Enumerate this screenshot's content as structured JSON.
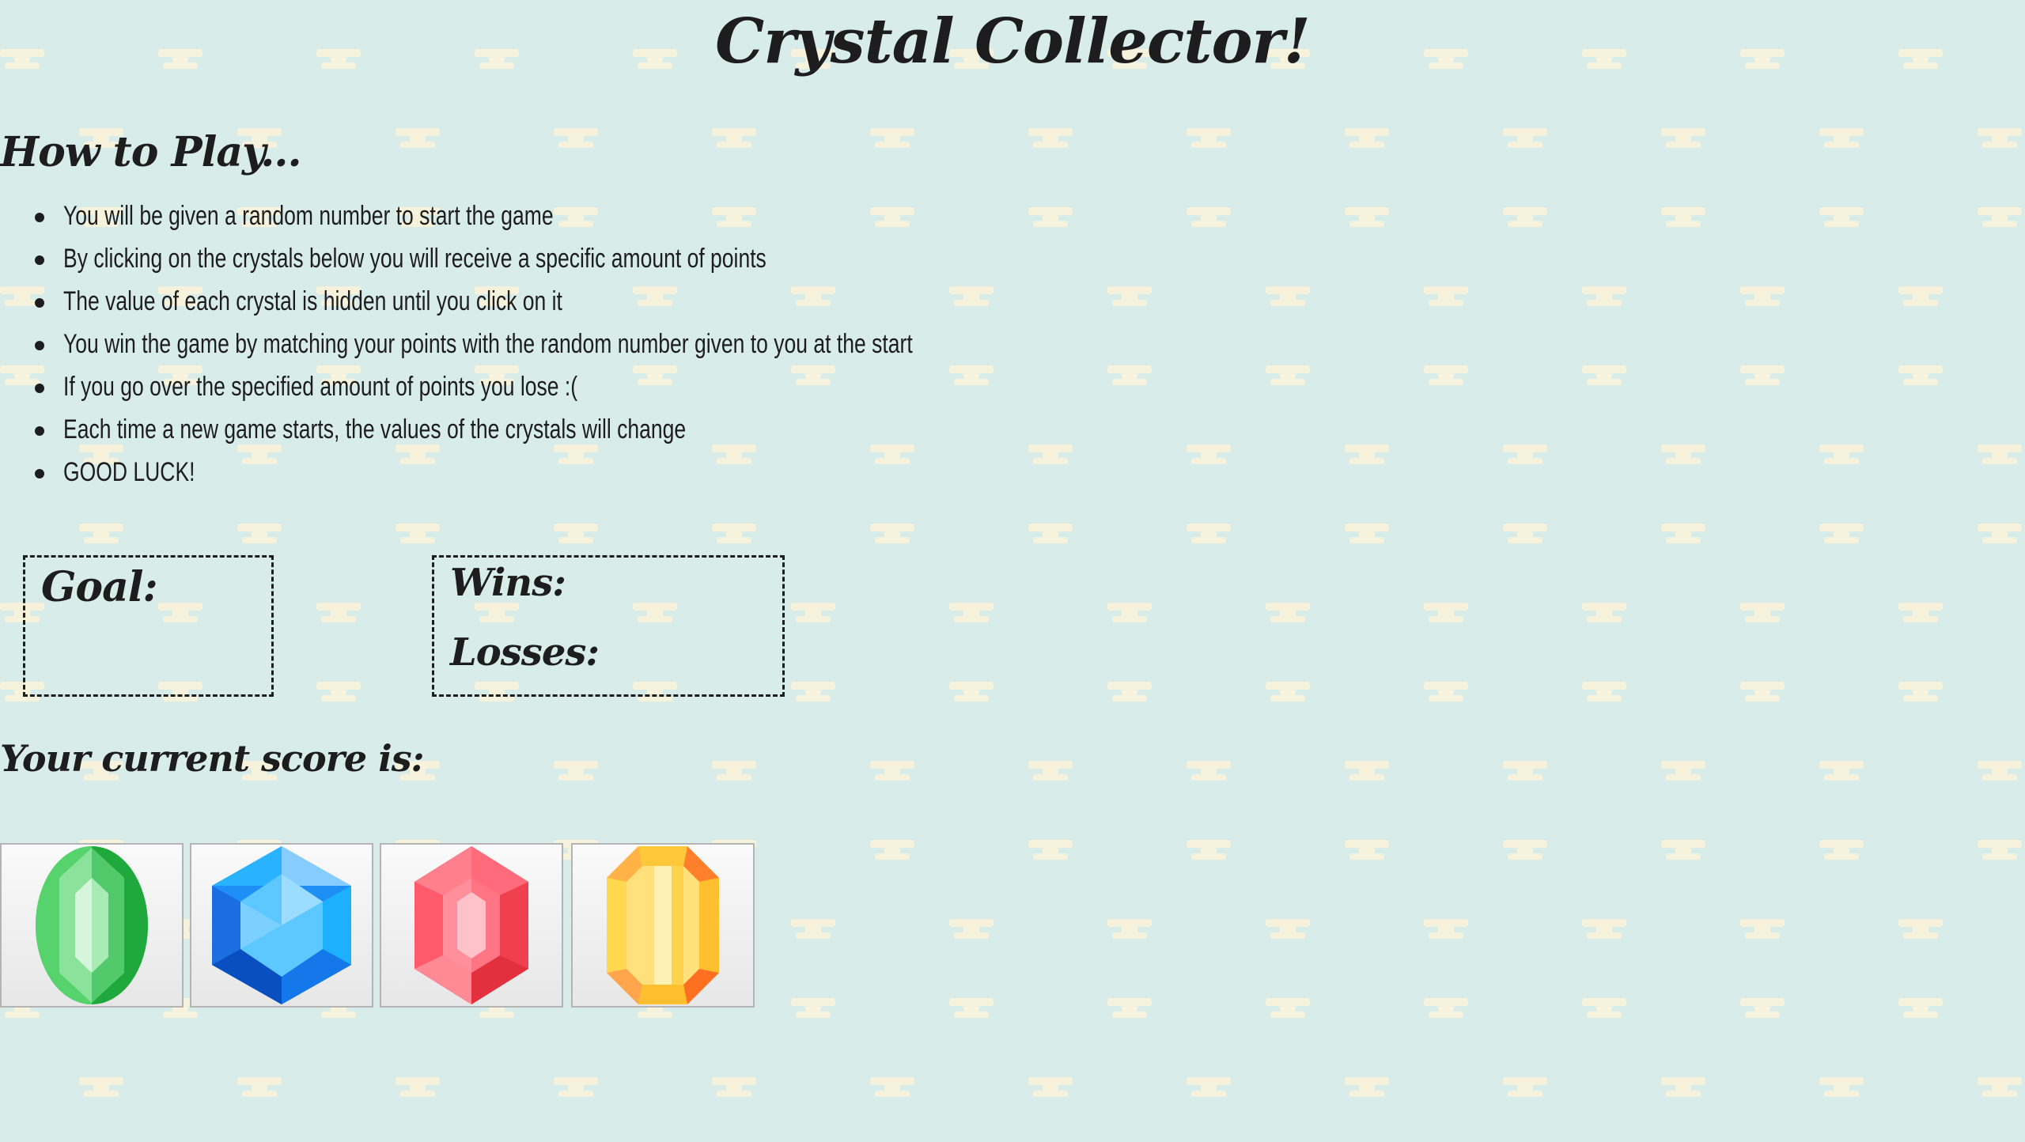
{
  "title": "Crystal Collector!",
  "instructions": {
    "heading": "How to Play...",
    "rules": [
      "You will be given a random number to start the game",
      "By clicking on the crystals below you will receive a specific amount of points",
      "The value of each crystal is hidden until you click on it",
      "You win the game by matching your points with the random number given to you at the start",
      "If you go over the specified amount of points you lose :(",
      "Each time a new game starts, the values of the crystals will change",
      "GOOD LUCK!"
    ]
  },
  "goal": {
    "label": "Goal:"
  },
  "stats": {
    "wins_label": "Wins:",
    "losses_label": "Losses:"
  },
  "score": {
    "label": "Your current score is:"
  },
  "crystals": [
    {
      "name": "green-crystal",
      "color": "#3fc25a"
    },
    {
      "name": "blue-crystal",
      "color": "#1e90f5"
    },
    {
      "name": "red-crystal",
      "color": "#f0404f"
    },
    {
      "name": "yellow-crystal",
      "color": "#ffd24d"
    }
  ],
  "colors": {
    "background": "#d8ecea",
    "pattern": "#f7f2dc",
    "text": "#1d1d1d"
  }
}
